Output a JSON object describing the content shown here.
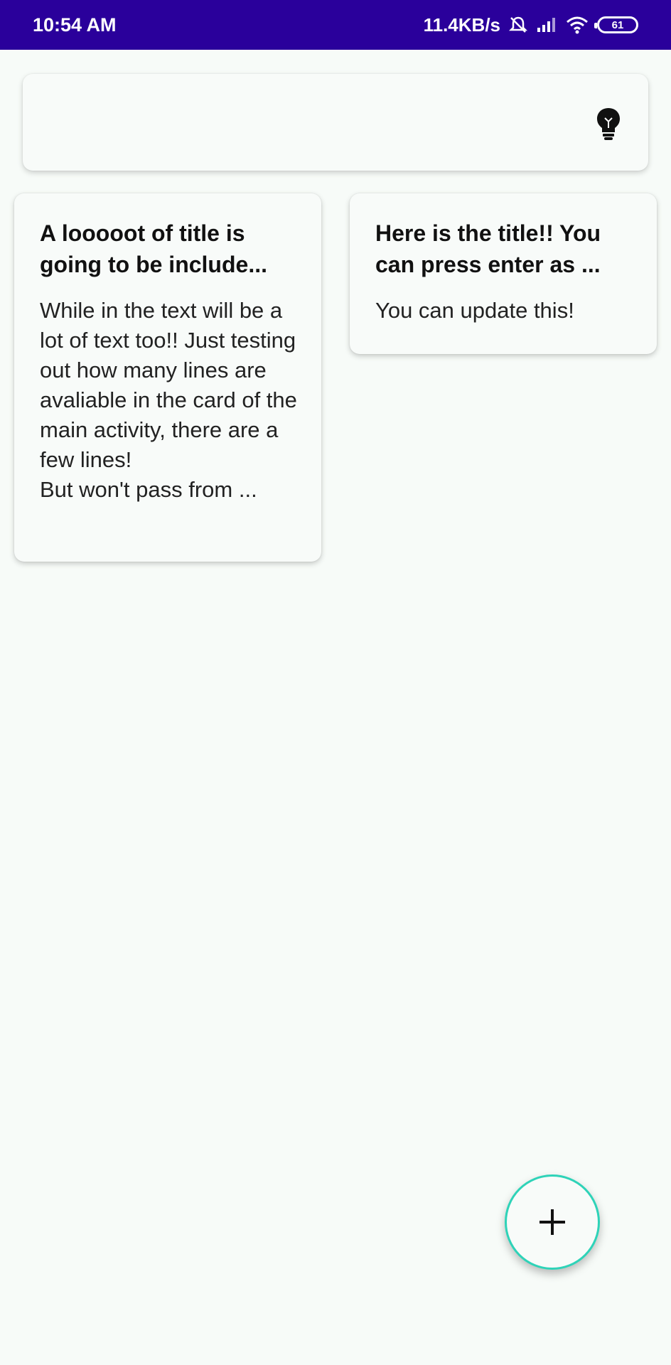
{
  "status_bar": {
    "time": "10:54 AM",
    "network_speed": "11.4KB/s",
    "battery_level": "61",
    "icons": [
      "mute-bell-icon",
      "signal-icon",
      "wifi-icon",
      "battery-icon"
    ],
    "background": "#2a009b"
  },
  "top_card": {
    "icon": "lightbulb-icon"
  },
  "notes": [
    {
      "title": "A looooot of title is going to be include...",
      "body": "While in the text will be a lot of text too!! Just testing out how many lines are avaliable in the card of the main activity, there are a few lines!\nBut won't pass from ..."
    },
    {
      "title": "Here is the title!! You can press enter as ...",
      "body": "You can update this!"
    }
  ],
  "fab": {
    "icon": "plus-icon",
    "accent": "#2ed3b8"
  }
}
